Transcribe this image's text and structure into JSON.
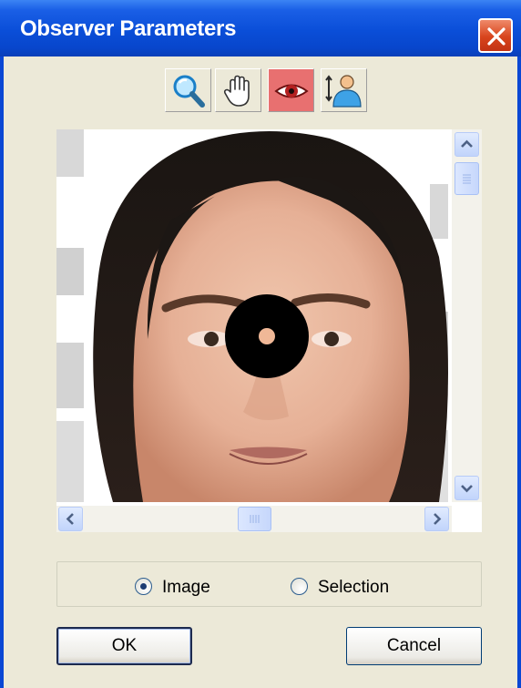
{
  "window": {
    "title": "Observer Parameters"
  },
  "toolbar": {
    "tools": [
      {
        "name": "zoom-tool",
        "icon": "magnifier-icon",
        "active": false
      },
      {
        "name": "pan-tool",
        "icon": "hand-icon",
        "active": false
      },
      {
        "name": "observer-tool",
        "icon": "eye-icon",
        "active": true
      },
      {
        "name": "person-tool",
        "icon": "person-icon",
        "active": false
      }
    ]
  },
  "viewer": {
    "image": "face-photo"
  },
  "scope": {
    "options": [
      {
        "label": "Image",
        "selected": true
      },
      {
        "label": "Selection",
        "selected": false
      }
    ]
  },
  "buttons": {
    "ok": "OK",
    "cancel": "Cancel"
  },
  "colors": {
    "titlebar": "#0a4ed8",
    "dialog_bg": "#ece9d8",
    "active_tool": "#e87070",
    "close_button": "#d8441c"
  }
}
